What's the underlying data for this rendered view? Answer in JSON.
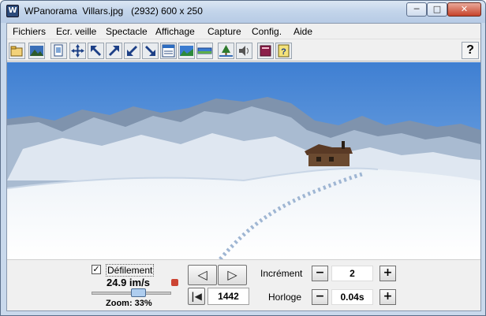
{
  "window": {
    "title": "WPanorama  Villars.jpg   (2932) 600 x 250",
    "app_icon_letter": "W",
    "minimize_icon": "minimize-icon",
    "maximize_icon": "maximize-icon",
    "close_icon": "close-icon"
  },
  "menu": [
    "Fichiers",
    "Ecr. veille",
    "Spectacle",
    "Affichage",
    "Capture",
    "Config.",
    "Aide"
  ],
  "toolbar": {
    "icons": [
      "open-folder-icon",
      "landscape-image-icon",
      "page-copy-icon",
      "move-arrows-icon",
      "arrow-upleft-icon",
      "arrow-upright-icon",
      "arrow-downleft-icon",
      "arrow-downright-icon",
      "calendar-view-icon",
      "fit-view-icon",
      "panorama-strip-icon",
      "tree-icon",
      "speaker-icon",
      "book-icon",
      "help-page-icon"
    ],
    "help_label": "?"
  },
  "controls": {
    "scroll_checked": true,
    "scroll_label": "Défilement",
    "speed": "24.9 im/s",
    "zoom": "Zoom: 33%",
    "speed_fraction": 0.55,
    "frame": "1442",
    "increment_label": "Incrément",
    "increment_value": "2",
    "clock_label": "Horloge",
    "clock_value": "0.04s",
    "minus": "−",
    "plus": "+",
    "prev_icon": "triangle-left-icon",
    "next_icon": "triangle-right-icon",
    "first_icon": "skip-first-icon"
  },
  "colors": {
    "sky": "#4d8ad6",
    "snow": "#f6f8fb",
    "mountain": "#7a8ea8"
  }
}
